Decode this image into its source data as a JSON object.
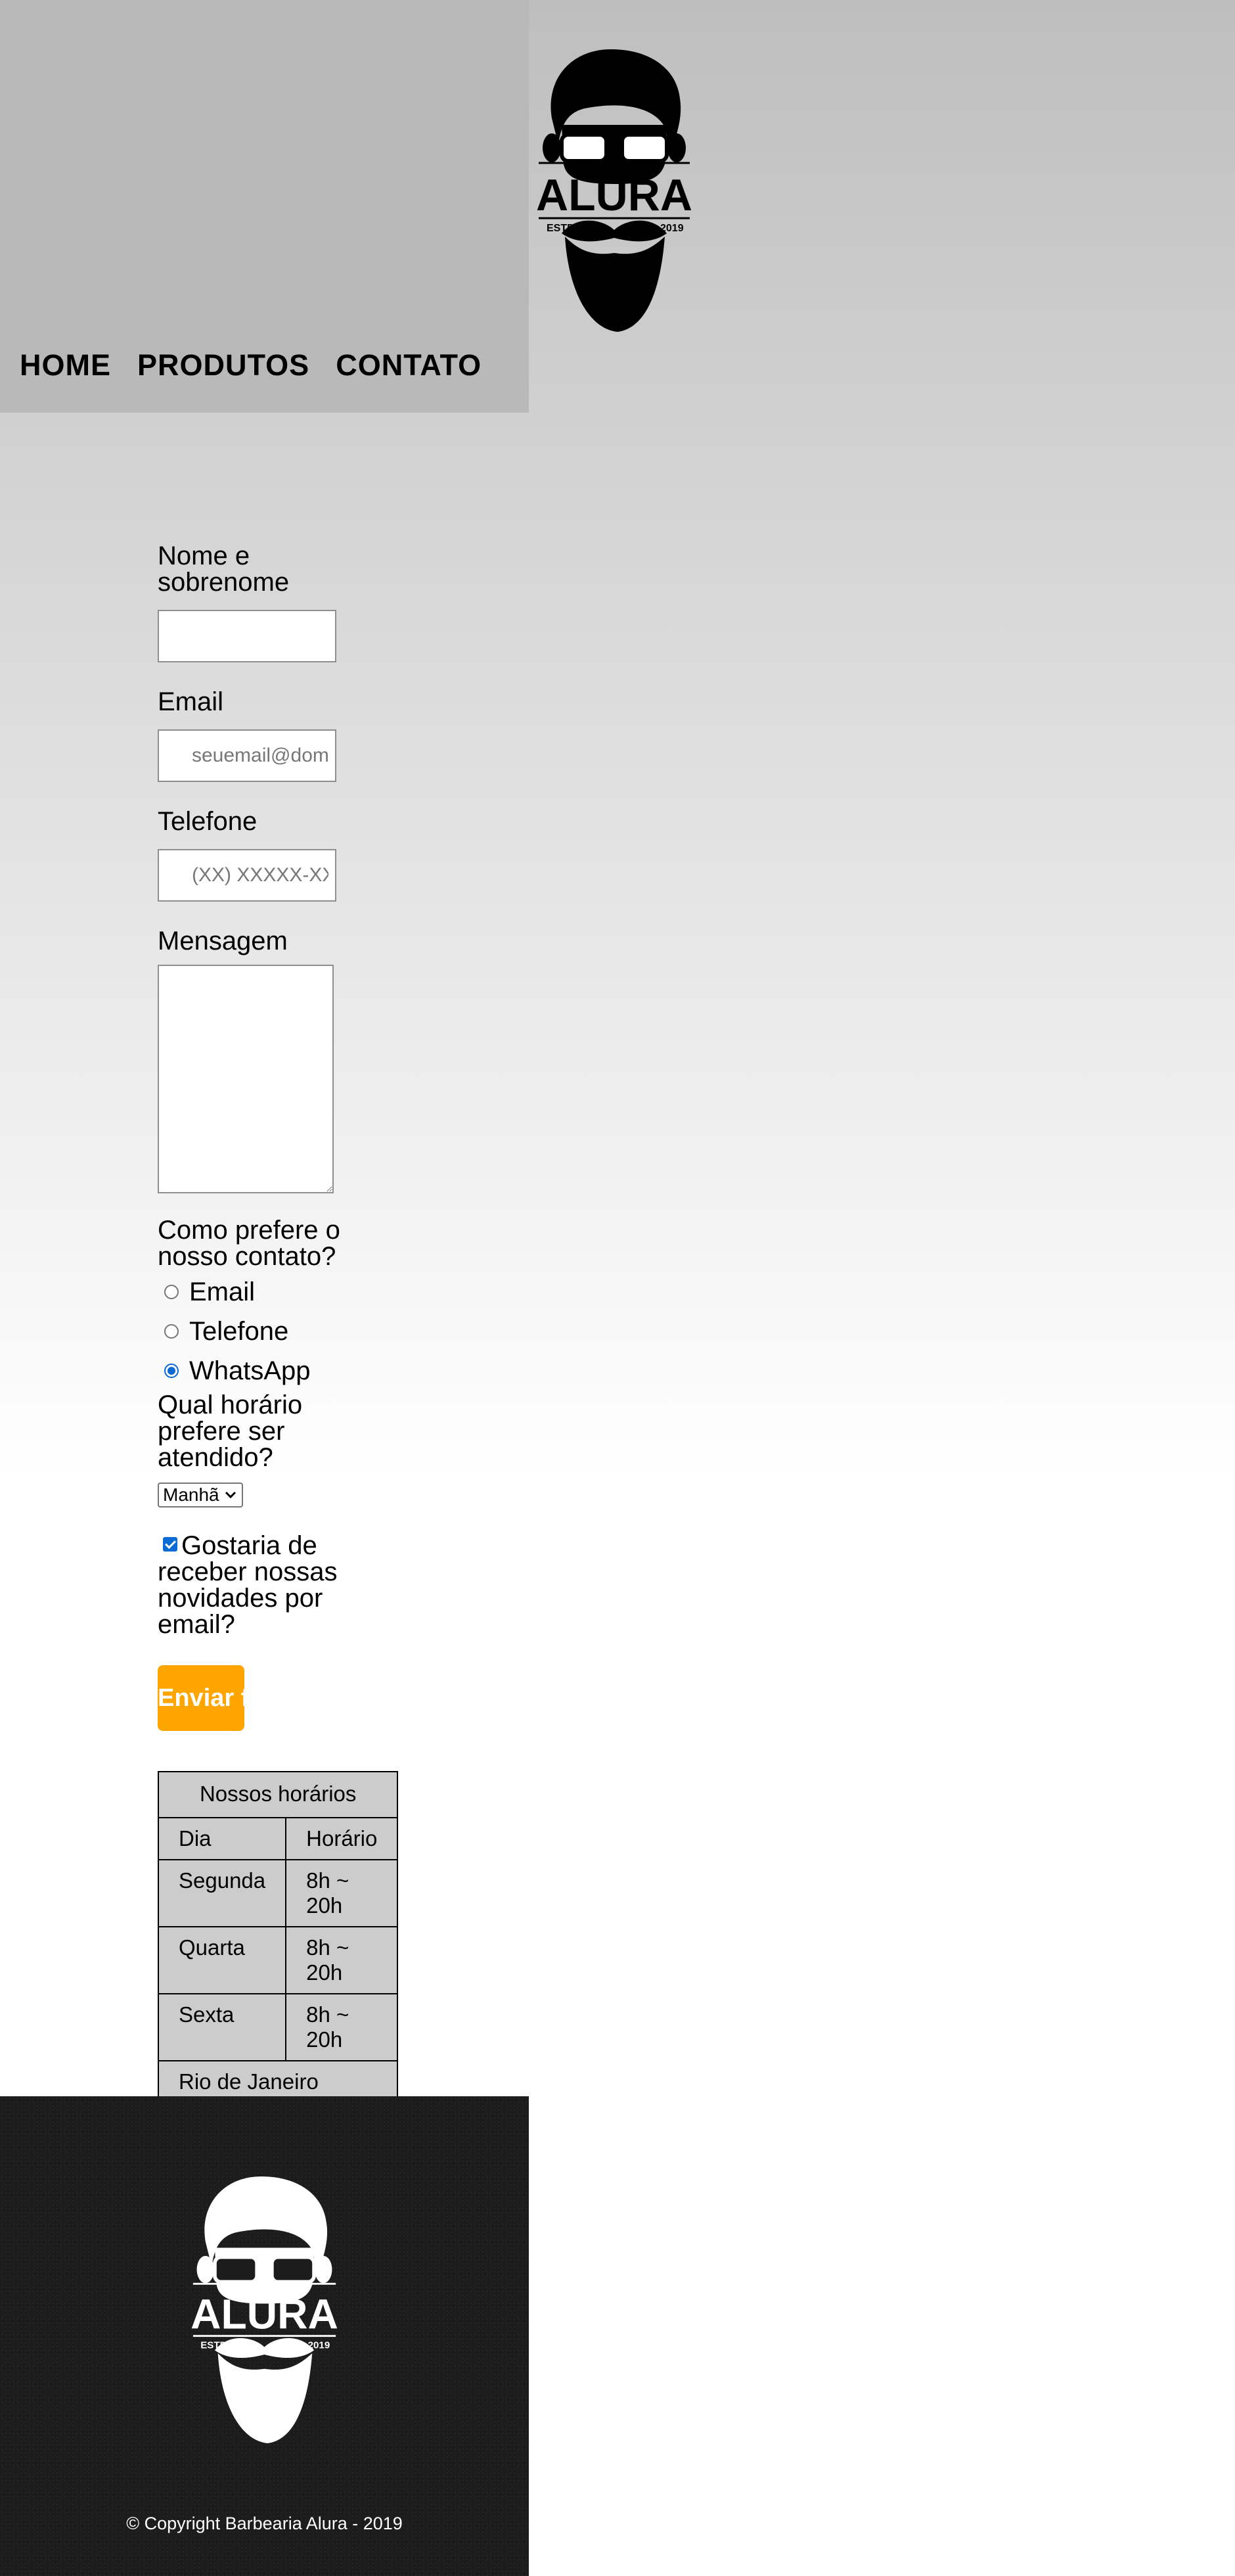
{
  "brand": {
    "name": "ALURA",
    "estd": "ESTD",
    "year": "2019"
  },
  "nav": {
    "items": [
      "HOME",
      "PRODUTOS",
      "CONTATO"
    ]
  },
  "form": {
    "name_label": "Nome e sobrenome",
    "name_value": "",
    "email_label": "Email",
    "email_placeholder": "seuemail@dominio.com",
    "phone_label": "Telefone",
    "phone_placeholder": "(XX) XXXXX-XXXX",
    "message_label": "Mensagem",
    "contact_question": "Como prefere o nosso contato?",
    "contact_options": [
      "Email",
      "Telefone",
      "WhatsApp"
    ],
    "contact_selected": "WhatsApp",
    "time_question": "Qual horário prefere ser atendido?",
    "time_selected": "Manhã",
    "newsletter_label": "Gostaria de receber nossas novidades por email?",
    "newsletter_checked": true,
    "submit_label": "Enviar formulário"
  },
  "table": {
    "caption": "Nossos horários",
    "headers": [
      "Dia",
      "Horário"
    ],
    "rows": [
      {
        "day": "Segunda",
        "hours": "8h ~ 20h"
      },
      {
        "day": "Quarta",
        "hours": "8h ~ 20h"
      },
      {
        "day": "Sexta",
        "hours": "8h ~ 20h"
      }
    ],
    "footer": "Rio de Janeiro"
  },
  "footer": {
    "copyright": "© Copyright Barbearia Alura - 2019"
  },
  "colors": {
    "accent": "#ffa500",
    "header_bg": "#b9b9b9",
    "footer_bg": "#1b1c1b",
    "table_bg": "#cccccc",
    "checked": "#0a6ad6"
  }
}
